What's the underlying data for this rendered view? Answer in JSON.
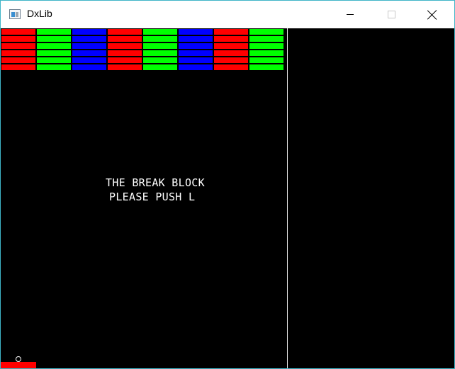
{
  "window": {
    "title": "DxLib",
    "buttons": {
      "minimize": "minimize-icon",
      "maximize": "maximize-icon",
      "close": "close-icon"
    }
  },
  "game": {
    "message_line1": "THE BREAK BLOCK",
    "message_line2": "PLEASE PUSH L",
    "block_grid": {
      "rows": 6,
      "columns": 8,
      "column_colors": [
        "#ff0000",
        "#00ff00",
        "#0000ff",
        "#ff0000",
        "#00ff00",
        "#0000ff",
        "#ff0000",
        "#00ff00"
      ]
    },
    "paddle_color": "#ff0000",
    "ball_color": "#ffffff",
    "background_color": "#000000"
  }
}
